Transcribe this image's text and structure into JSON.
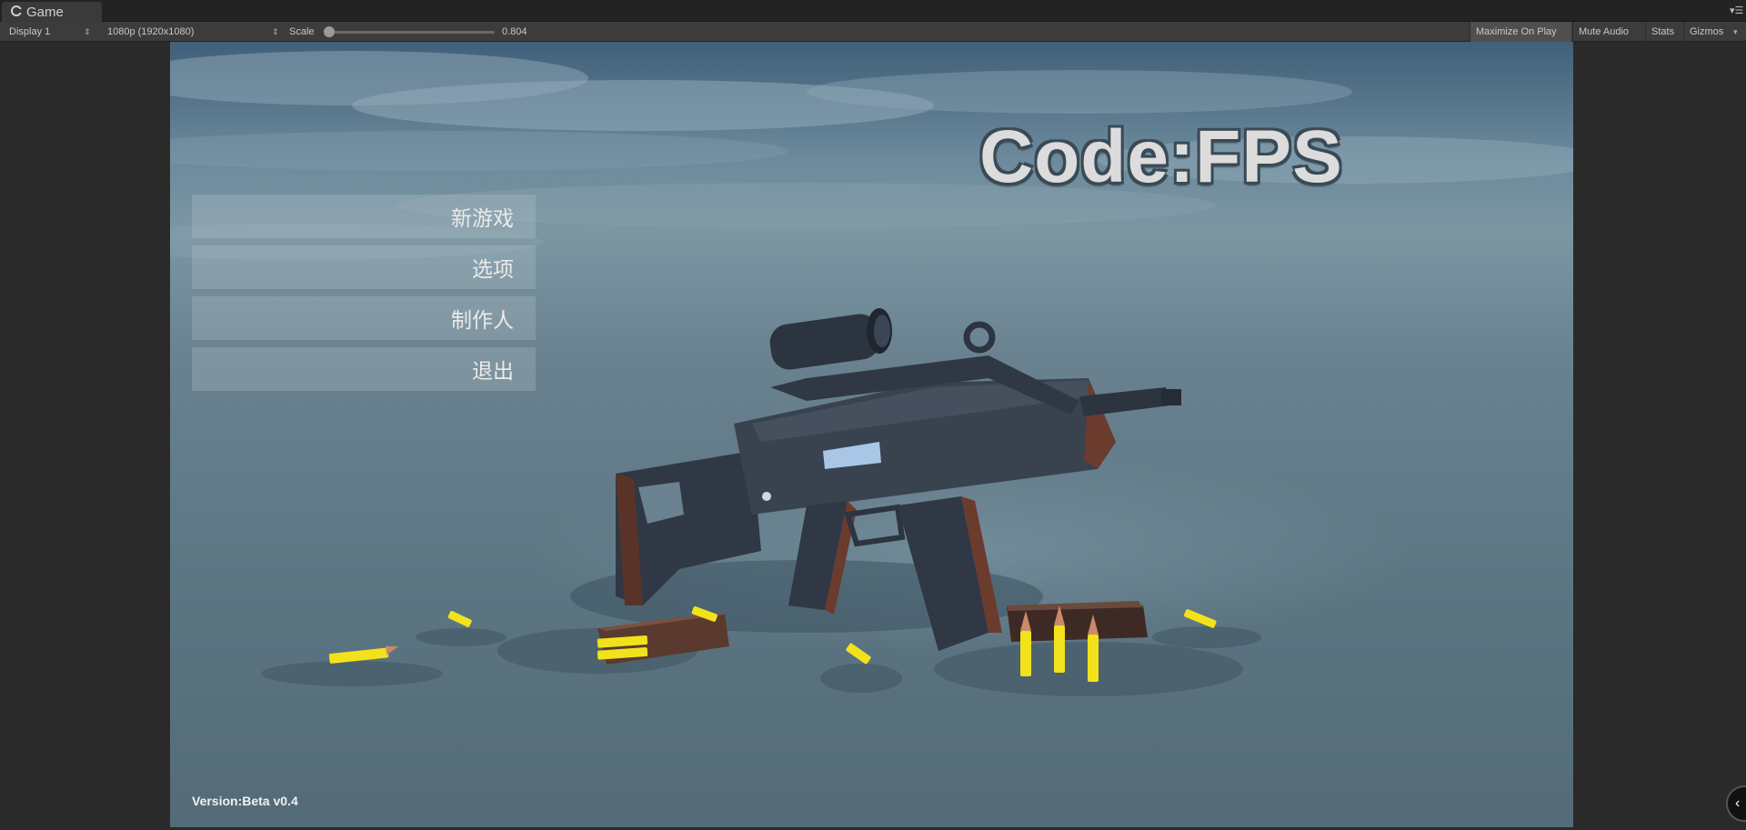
{
  "tab": {
    "title": "Game",
    "icon": "unity-logo-icon",
    "menu_icon": "panel-menu-icon"
  },
  "toolbar": {
    "display": "Display 1",
    "resolution": "1080p (1920x1080)",
    "scale_label": "Scale",
    "scale_value": "0.804",
    "maximize_on_play": "Maximize On Play",
    "mute_audio": "Mute Audio",
    "stats": "Stats",
    "gizmos": "Gizmos"
  },
  "game": {
    "title": "Code:FPS",
    "menu": [
      {
        "label": "新游戏"
      },
      {
        "label": "选项"
      },
      {
        "label": "制作人"
      },
      {
        "label": "退出"
      }
    ],
    "version": "Version:Beta v0.4"
  },
  "colors": {
    "editor_bg": "#2a2a2a",
    "toolbar_bg": "#3c3c3c",
    "title_text": "#dcdcdc",
    "bullet_yellow": "#f2e21b",
    "rifle": "#3b4451",
    "wood": "#6b3b2e"
  }
}
